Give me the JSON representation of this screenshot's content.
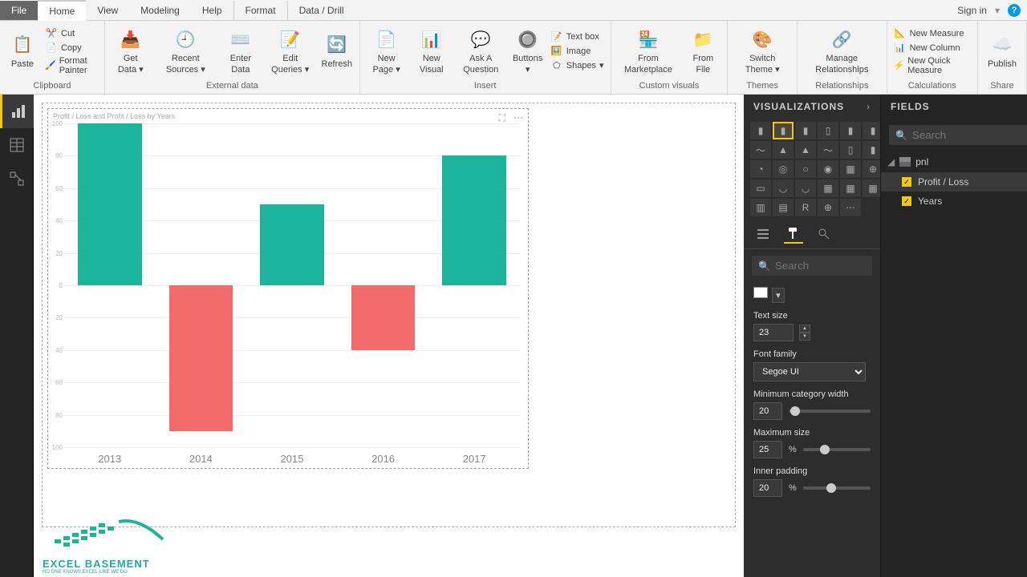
{
  "app": {
    "signin": "Sign in"
  },
  "tabs": {
    "file": "File",
    "home": "Home",
    "view": "View",
    "modeling": "Modeling",
    "help": "Help",
    "format": "Format",
    "datadrill": "Data / Drill"
  },
  "ribbon": {
    "paste": "Paste",
    "cut": "Cut",
    "copy": "Copy",
    "format_painter": "Format Painter",
    "get_data": "Get Data",
    "recent_sources": "Recent Sources",
    "enter_data": "Enter Data",
    "edit_queries": "Edit Queries",
    "refresh": "Refresh",
    "new_page": "New Page",
    "new_visual": "New Visual",
    "ask_question": "Ask A Question",
    "buttons": "Buttons",
    "text_box": "Text box",
    "image": "Image",
    "shapes": "Shapes",
    "from_marketplace": "From Marketplace",
    "from_file": "From File",
    "switch_theme": "Switch Theme",
    "manage_relationships": "Manage Relationships",
    "new_measure": "New Measure",
    "new_column": "New Column",
    "new_quick_measure": "New Quick Measure",
    "publish": "Publish",
    "groups": {
      "clipboard": "Clipboard",
      "external_data": "External data",
      "insert": "Insert",
      "custom_visuals": "Custom visuals",
      "themes": "Themes",
      "relationships": "Relationships",
      "calculations": "Calculations",
      "share": "Share"
    }
  },
  "panels": {
    "viz": "VISUALIZATIONS",
    "fields": "FIELDS",
    "search_placeholder": "Search",
    "props": {
      "text_size": {
        "label": "Text size",
        "value": "23"
      },
      "font_family": {
        "label": "Font family",
        "value": "Segoe UI"
      },
      "min_cat_width": {
        "label": "Minimum category width",
        "value": "20"
      },
      "max_size": {
        "label": "Maximum size",
        "value": "25",
        "suffix": "%"
      },
      "inner_padding": {
        "label": "Inner padding",
        "value": "20",
        "suffix": "%"
      }
    }
  },
  "fields": {
    "table": "pnl",
    "items": [
      {
        "label": "Profit / Loss",
        "checked": true
      },
      {
        "label": "Years",
        "checked": true
      }
    ]
  },
  "chart_data": {
    "type": "bar",
    "title": "Profit / Loss and Profit / Loss by Years",
    "categories": [
      "2013",
      "2014",
      "2015",
      "2016",
      "2017"
    ],
    "values": [
      100,
      -90,
      50,
      -40,
      80
    ],
    "ylim": [
      -100,
      100
    ],
    "colors": {
      "positive": "#1cb59b",
      "negative": "#f36b6b"
    }
  },
  "logo": {
    "main": "EXCEL BASEMENT",
    "sub": "NO ONE KNOWS EXCEL LIKE WE DO"
  }
}
